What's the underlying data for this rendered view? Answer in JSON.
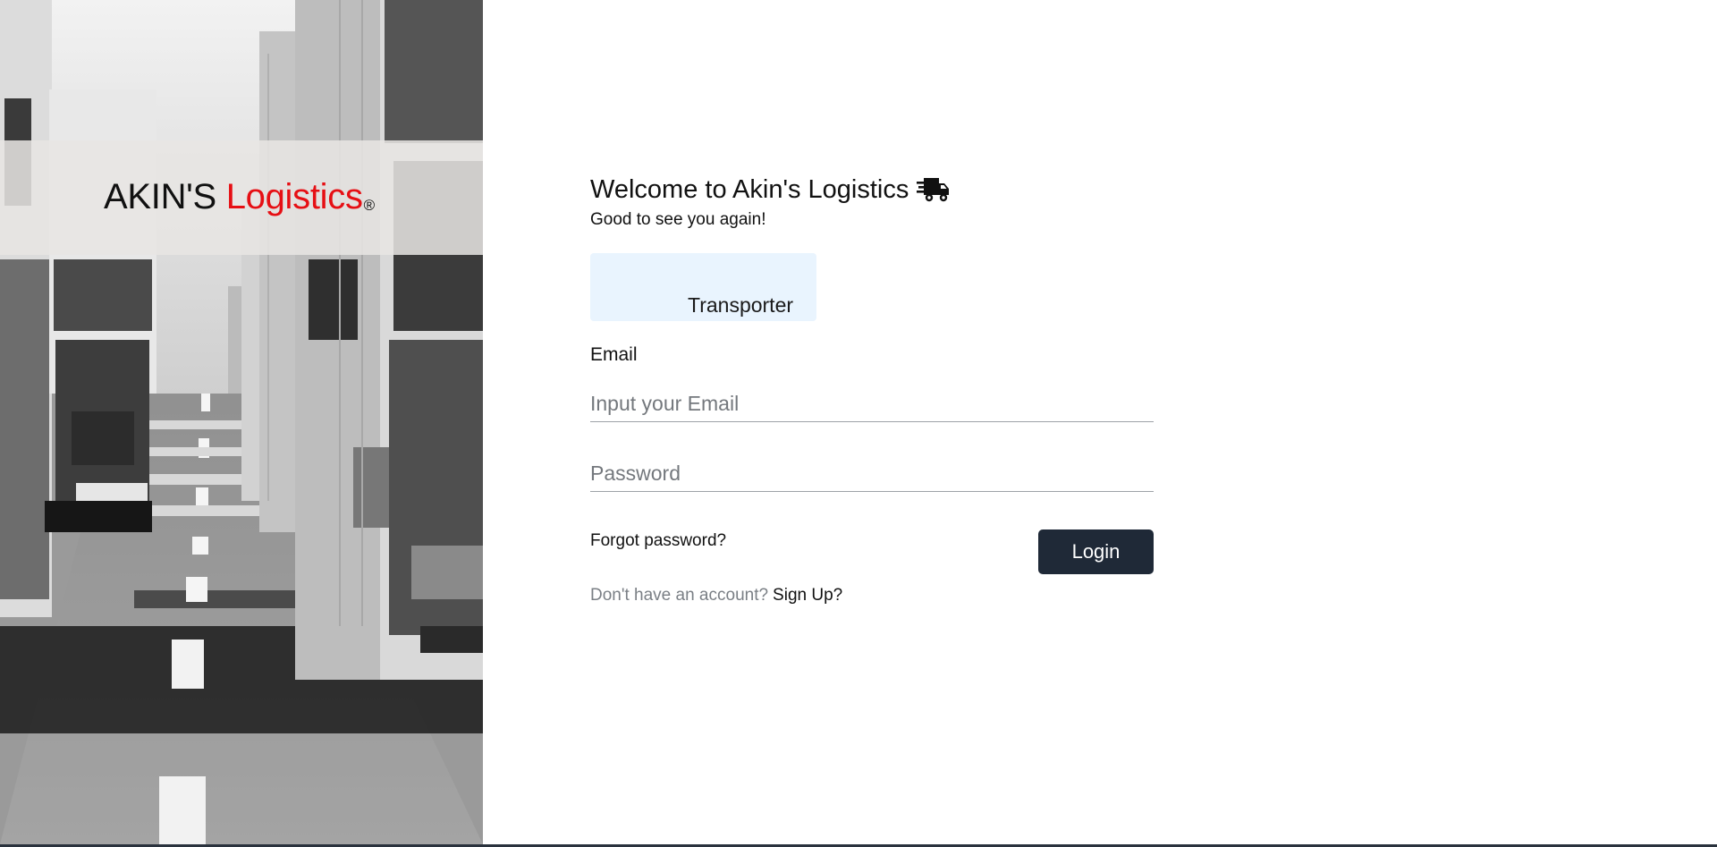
{
  "brand": {
    "name_prefix": "AKIN'S",
    "name_highlight": "Logistics",
    "registered_mark": "®",
    "highlight_color": "#e60f14"
  },
  "login": {
    "welcome_title": "Welcome to Akin's Logistics",
    "title_icon": "shipping-fast-truck-icon",
    "subtitle": "Good to see you again!",
    "role_tab_label": "Transporter",
    "email_label": "Email",
    "email_placeholder": "Input your Email",
    "password_placeholder": "Password",
    "forgot_password": "Forgot password?",
    "login_button": "Login",
    "no_account_text": "Don't have an account?",
    "signup_link": "Sign Up?"
  },
  "colors": {
    "button_bg": "#1f2937",
    "role_tab_bg": "#e9f4fe"
  }
}
